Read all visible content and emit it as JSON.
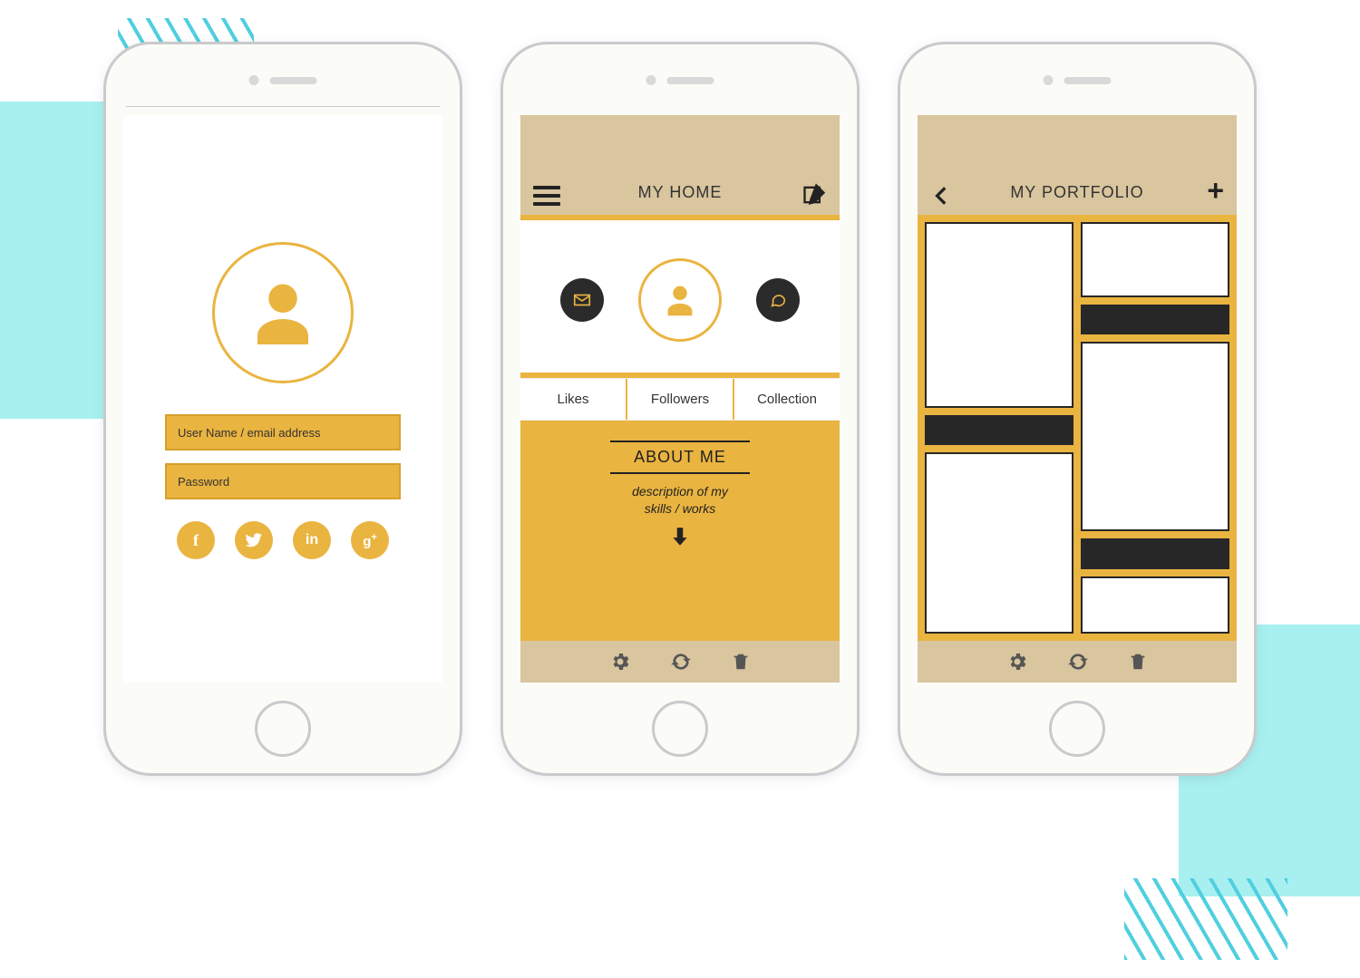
{
  "colors": {
    "accent": "#eab440",
    "tan": "#d9c59e",
    "dark": "#2b2b2b"
  },
  "login": {
    "username_placeholder": "User Name / email address",
    "password_placeholder": "Password",
    "social": [
      "facebook",
      "twitter",
      "linkedin",
      "google-plus"
    ]
  },
  "home": {
    "nav_title": "MY HOME",
    "tabs": [
      "Likes",
      "Followers",
      "Collection"
    ],
    "about_title": "ABOUT ME",
    "about_line1": "description of my",
    "about_line2": "skills / works"
  },
  "portfolio": {
    "nav_title": "MY PORTFOLIO"
  }
}
